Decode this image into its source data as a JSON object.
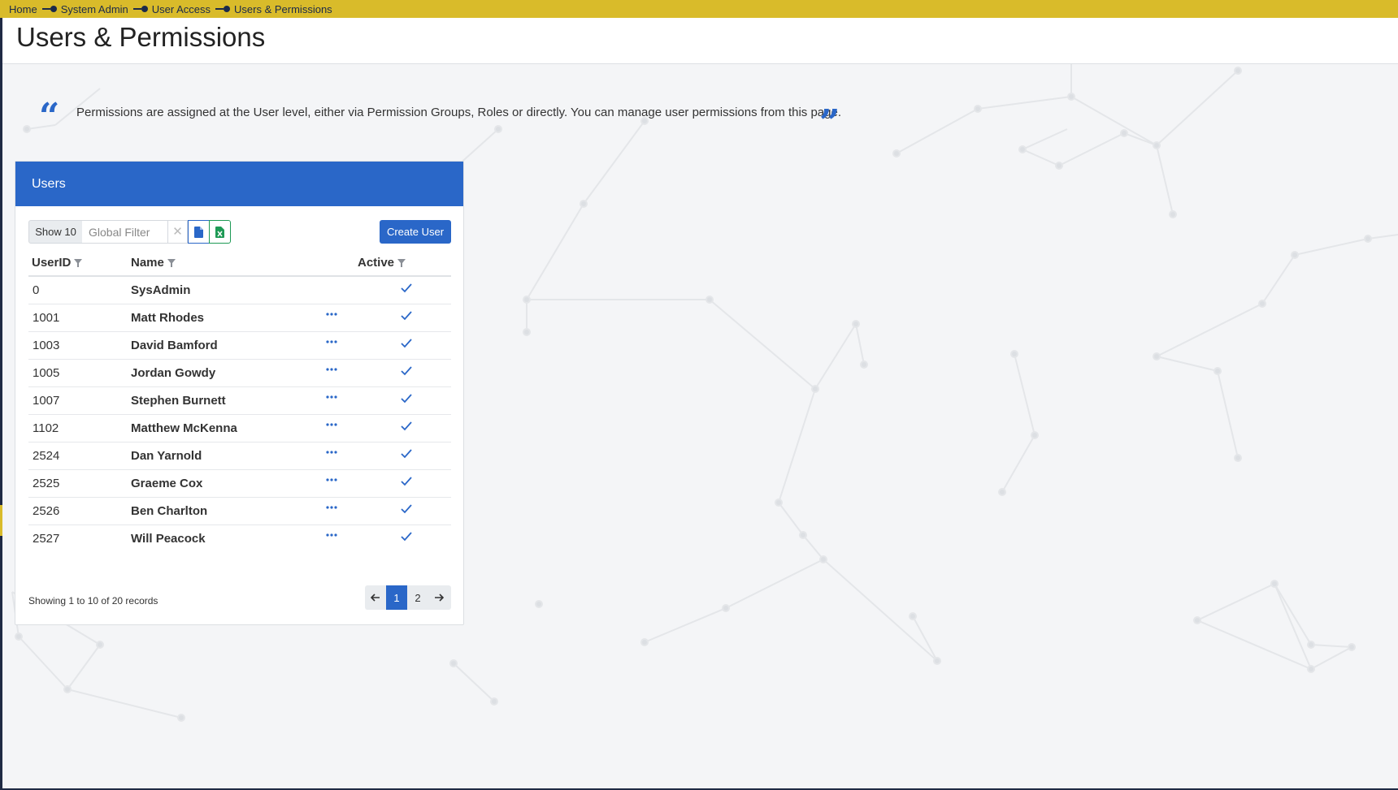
{
  "breadcrumb": [
    "Home",
    "System Admin",
    "User Access",
    "Users & Permissions"
  ],
  "page_title": "Users & Permissions",
  "info_text": "Permissions are assigned at the User level, either via Permission Groups, Roles or directly. You can manage user permissions from this page.",
  "panel": {
    "title": "Users",
    "show_label": "Show 10",
    "filter_placeholder": "Global Filter",
    "clear_glyph": "✕",
    "create_label": "Create User",
    "columns": {
      "userid": "UserID",
      "name": "Name",
      "active": "Active"
    },
    "rows": [
      {
        "id": "0",
        "name": "SysAdmin",
        "more": false,
        "active": true
      },
      {
        "id": "1001",
        "name": "Matt Rhodes",
        "more": true,
        "active": true
      },
      {
        "id": "1003",
        "name": "David Bamford",
        "more": true,
        "active": true
      },
      {
        "id": "1005",
        "name": "Jordan Gowdy",
        "more": true,
        "active": true
      },
      {
        "id": "1007",
        "name": "Stephen Burnett",
        "more": true,
        "active": true
      },
      {
        "id": "1102",
        "name": "Matthew McKenna",
        "more": true,
        "active": true
      },
      {
        "id": "2524",
        "name": "Dan Yarnold",
        "more": true,
        "active": true
      },
      {
        "id": "2525",
        "name": "Graeme Cox",
        "more": true,
        "active": true
      },
      {
        "id": "2526",
        "name": "Ben Charlton",
        "more": true,
        "active": true
      },
      {
        "id": "2527",
        "name": "Will Peacock",
        "more": true,
        "active": true
      }
    ],
    "footer_info": "Showing 1 to 10 of 20 records",
    "pages": [
      "1",
      "2"
    ],
    "current_page": "1"
  },
  "colors": {
    "accent": "#2a67c8",
    "breadcrumb_bar": "#d9bb2a",
    "excel_green": "#1e9a55"
  },
  "icons": [
    "quote-open-icon",
    "quote-close-icon",
    "funnel-icon",
    "more-icon",
    "check-icon",
    "document-icon",
    "excel-icon",
    "arrow-left-icon",
    "arrow-right-icon"
  ]
}
